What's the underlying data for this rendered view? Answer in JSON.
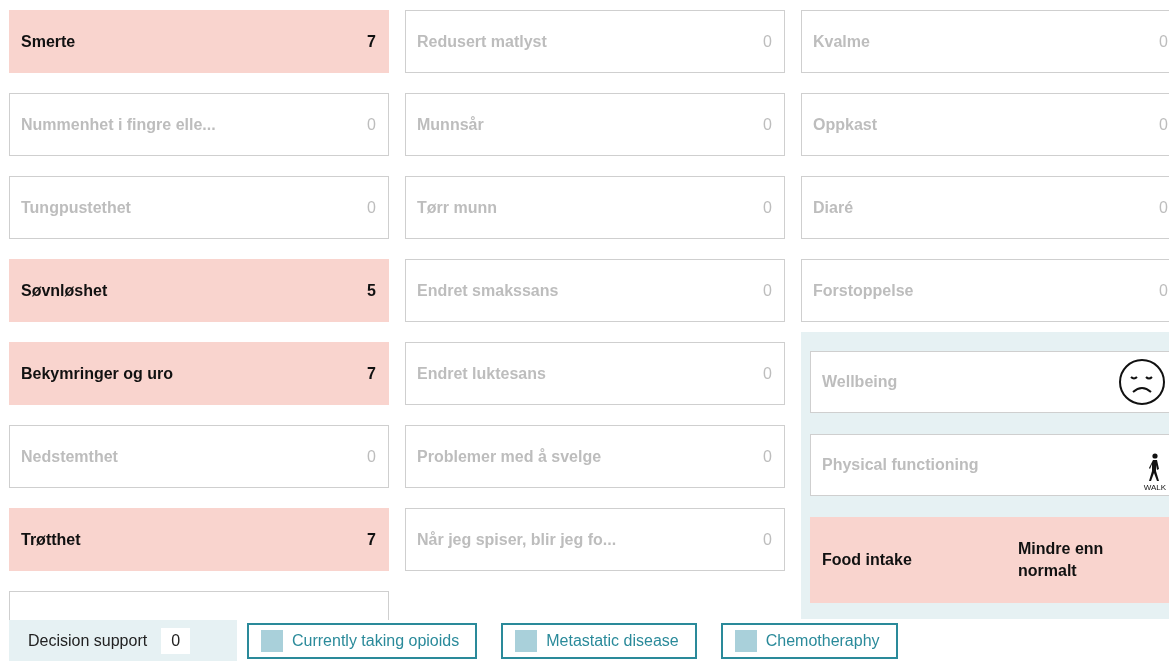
{
  "columns": [
    {
      "cards": [
        {
          "kind": "symptom",
          "label": "Smerte",
          "value": "7",
          "alert": true
        },
        {
          "kind": "symptom",
          "label": "Nummenhet i fingre elle...",
          "value": "0",
          "alert": false
        },
        {
          "kind": "symptom",
          "label": "Tungpustethet",
          "value": "0",
          "alert": false
        },
        {
          "kind": "symptom",
          "label": "Søvnløshet",
          "value": "5",
          "alert": true
        },
        {
          "kind": "symptom",
          "label": "Bekymringer og uro",
          "value": "7",
          "alert": true
        },
        {
          "kind": "symptom",
          "label": "Nedstemthet",
          "value": "0",
          "alert": false
        },
        {
          "kind": "symptom",
          "label": "Trøtthet",
          "value": "7",
          "alert": true
        },
        {
          "kind": "covered"
        }
      ]
    },
    {
      "cards": [
        {
          "kind": "symptom",
          "label": "Redusert matlyst",
          "value": "0",
          "alert": false
        },
        {
          "kind": "symptom",
          "label": "Munnsår",
          "value": "0",
          "alert": false
        },
        {
          "kind": "symptom",
          "label": "Tørr munn",
          "value": "0",
          "alert": false
        },
        {
          "kind": "symptom",
          "label": "Endret smakssans",
          "value": "0",
          "alert": false
        },
        {
          "kind": "symptom",
          "label": "Endret luktesans",
          "value": "0",
          "alert": false
        },
        {
          "kind": "symptom",
          "label": "Problemer med å svelge",
          "value": "0",
          "alert": false
        },
        {
          "kind": "symptom",
          "label": "Når jeg spiser, blir jeg fo...",
          "value": "0",
          "alert": false
        }
      ]
    },
    {
      "cards": [
        {
          "kind": "symptom",
          "label": "Kvalme",
          "value": "0",
          "alert": false
        },
        {
          "kind": "symptom",
          "label": "Oppkast",
          "value": "0",
          "alert": false
        },
        {
          "kind": "symptom",
          "label": "Diaré",
          "value": "0",
          "alert": false
        },
        {
          "kind": "symptom",
          "label": "Forstoppelse",
          "value": "0",
          "alert": false
        }
      ]
    }
  ],
  "function_panel": {
    "cards": [
      {
        "kind": "face",
        "label": "Wellbeing",
        "alert": false
      },
      {
        "kind": "walk",
        "label": "Physical functioning",
        "caption": "WALK",
        "alert": false
      },
      {
        "kind": "text",
        "label": "Food intake",
        "value": "Mindre enn normalt",
        "alert": true
      }
    ]
  },
  "decision_support": {
    "label": "Decision support",
    "value": "0"
  },
  "toggles": [
    {
      "label": "Currently taking opioids",
      "checked": false
    },
    {
      "label": "Metastatic disease",
      "checked": false
    },
    {
      "label": "Chemotheraphy",
      "checked": false
    }
  ]
}
